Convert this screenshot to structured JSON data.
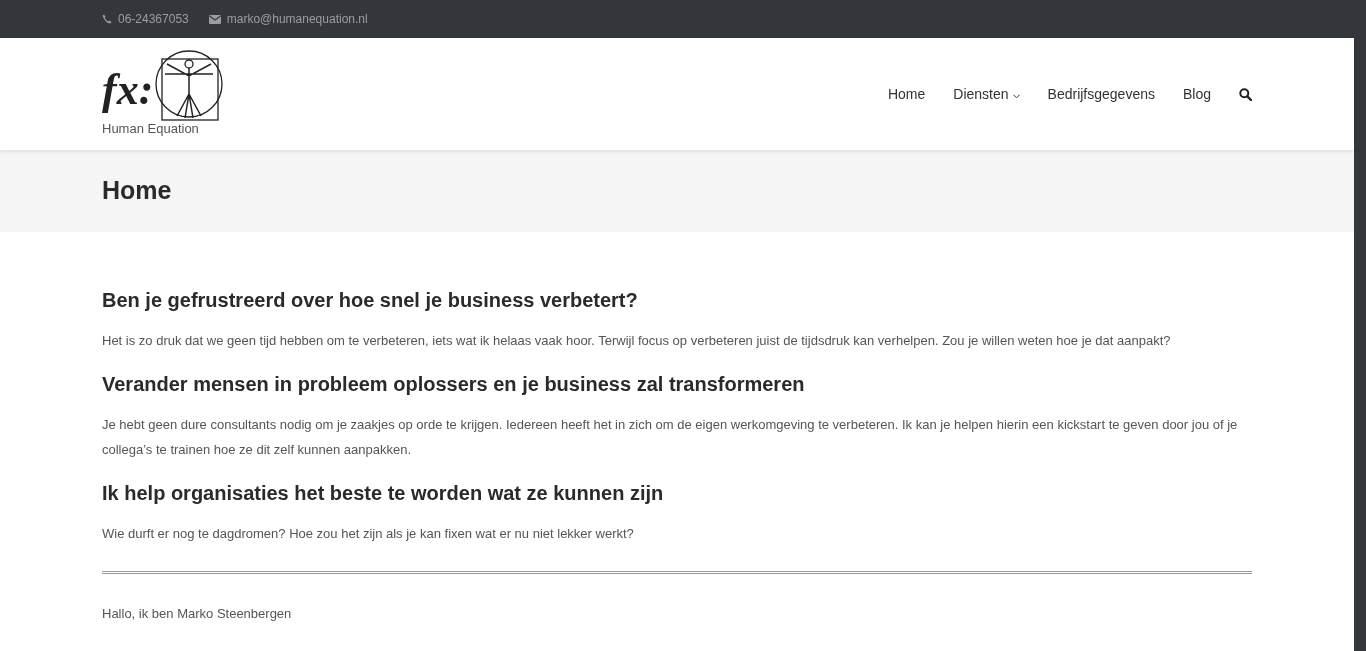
{
  "top_bar": {
    "phone": "06-24367053",
    "email": "marko@humanequation.nl"
  },
  "logo": {
    "mark": "fx:",
    "tagline": "Human Equation"
  },
  "nav": [
    {
      "label": "Home",
      "dropdown": false
    },
    {
      "label": "Diensten",
      "dropdown": true
    },
    {
      "label": "Bedrijfsgegevens",
      "dropdown": false
    },
    {
      "label": "Blog",
      "dropdown": false
    }
  ],
  "page_title": "Home",
  "sections": [
    {
      "heading": "Ben je gefrustreerd over hoe snel je business verbetert?",
      "text": "Het is zo druk dat we geen tijd hebben om te verbeteren, iets wat ik helaas vaak hoor. Terwijl focus op verbeteren juist de tijdsdruk kan verhelpen. Zou je willen weten hoe je dat aanpakt?"
    },
    {
      "heading": "Verander mensen in probleem oplossers en je business zal transformeren",
      "text": "Je hebt geen dure consultants nodig om je zaakjes op orde te krijgen. Iedereen heeft het in zich om de eigen werkomgeving te verbeteren. Ik kan je helpen hierin een kickstart te geven door jou of je collega’s te trainen hoe ze dit zelf kunnen aanpakken."
    },
    {
      "heading": "Ik help organisaties het beste te worden wat ze kunnen zijn",
      "text": "Wie durft er nog te dagdromen? Hoe zou het zijn als je kan fixen wat er nu niet lekker werkt?"
    }
  ],
  "intro": "Hallo, ik ben Marko Steenbergen"
}
